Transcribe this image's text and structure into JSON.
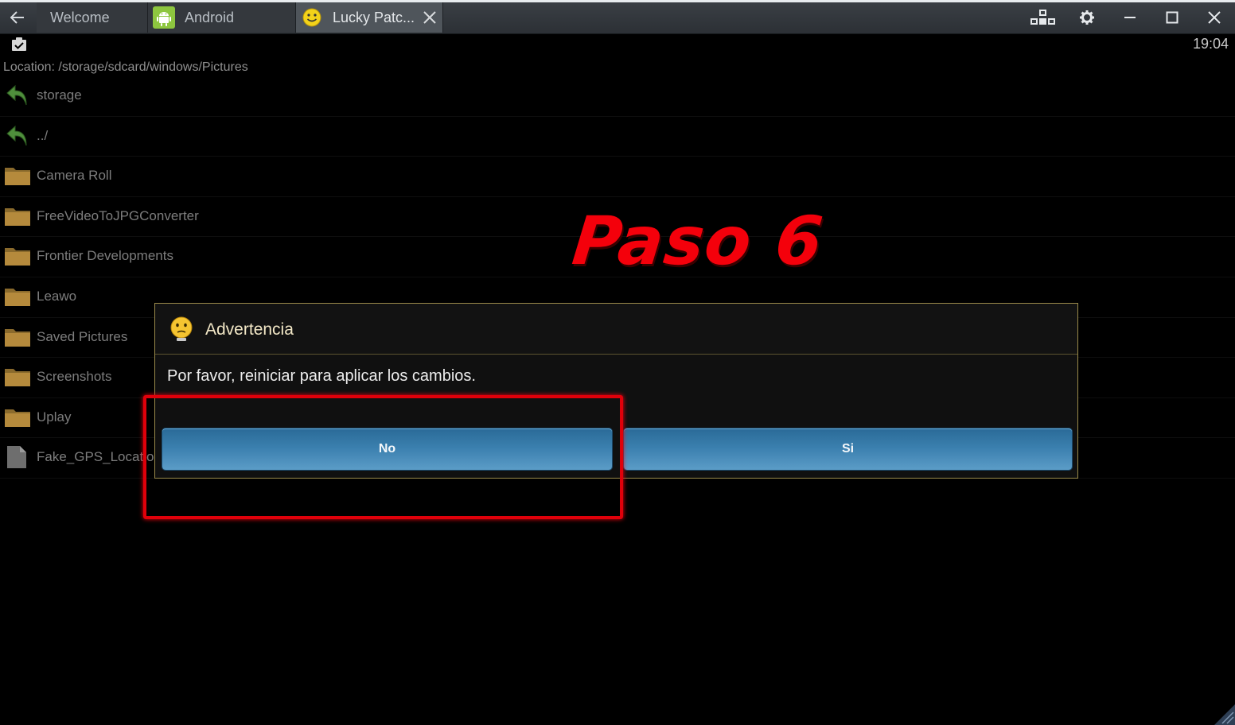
{
  "window": {
    "tabs": [
      {
        "label": "Welcome"
      },
      {
        "label": "Android"
      },
      {
        "label": "Lucky Patc..."
      }
    ]
  },
  "status": {
    "clock": "19:04"
  },
  "browser": {
    "location": "Location: /storage/sdcard/windows/Pictures",
    "items": [
      {
        "label": "storage",
        "icon": "back-arrow-icon"
      },
      {
        "label": "../",
        "icon": "back-arrow-icon"
      },
      {
        "label": "Camera Roll",
        "icon": "folder-icon"
      },
      {
        "label": "FreeVideoToJPGConverter",
        "icon": "folder-icon"
      },
      {
        "label": "Frontier Developments",
        "icon": "folder-icon"
      },
      {
        "label": "Leawo",
        "icon": "folder-icon"
      },
      {
        "label": "Saved Pictures",
        "icon": "folder-icon"
      },
      {
        "label": "Screenshots",
        "icon": "folder-icon"
      },
      {
        "label": "Uplay",
        "icon": "folder-icon"
      },
      {
        "label": "Fake_GPS_Location",
        "icon": "file-icon"
      }
    ]
  },
  "annotation": {
    "text": "Paso 6",
    "color": "#f4000b"
  },
  "dialog": {
    "title": "Advertencia",
    "message": "Por favor, reiniciar para aplicar los cambios.",
    "no_label": "No",
    "si_label": "Si"
  },
  "colors": {
    "accent_button": "#3a7fae",
    "dialog_border": "#9a8a4a",
    "highlight": "#e0000a"
  }
}
